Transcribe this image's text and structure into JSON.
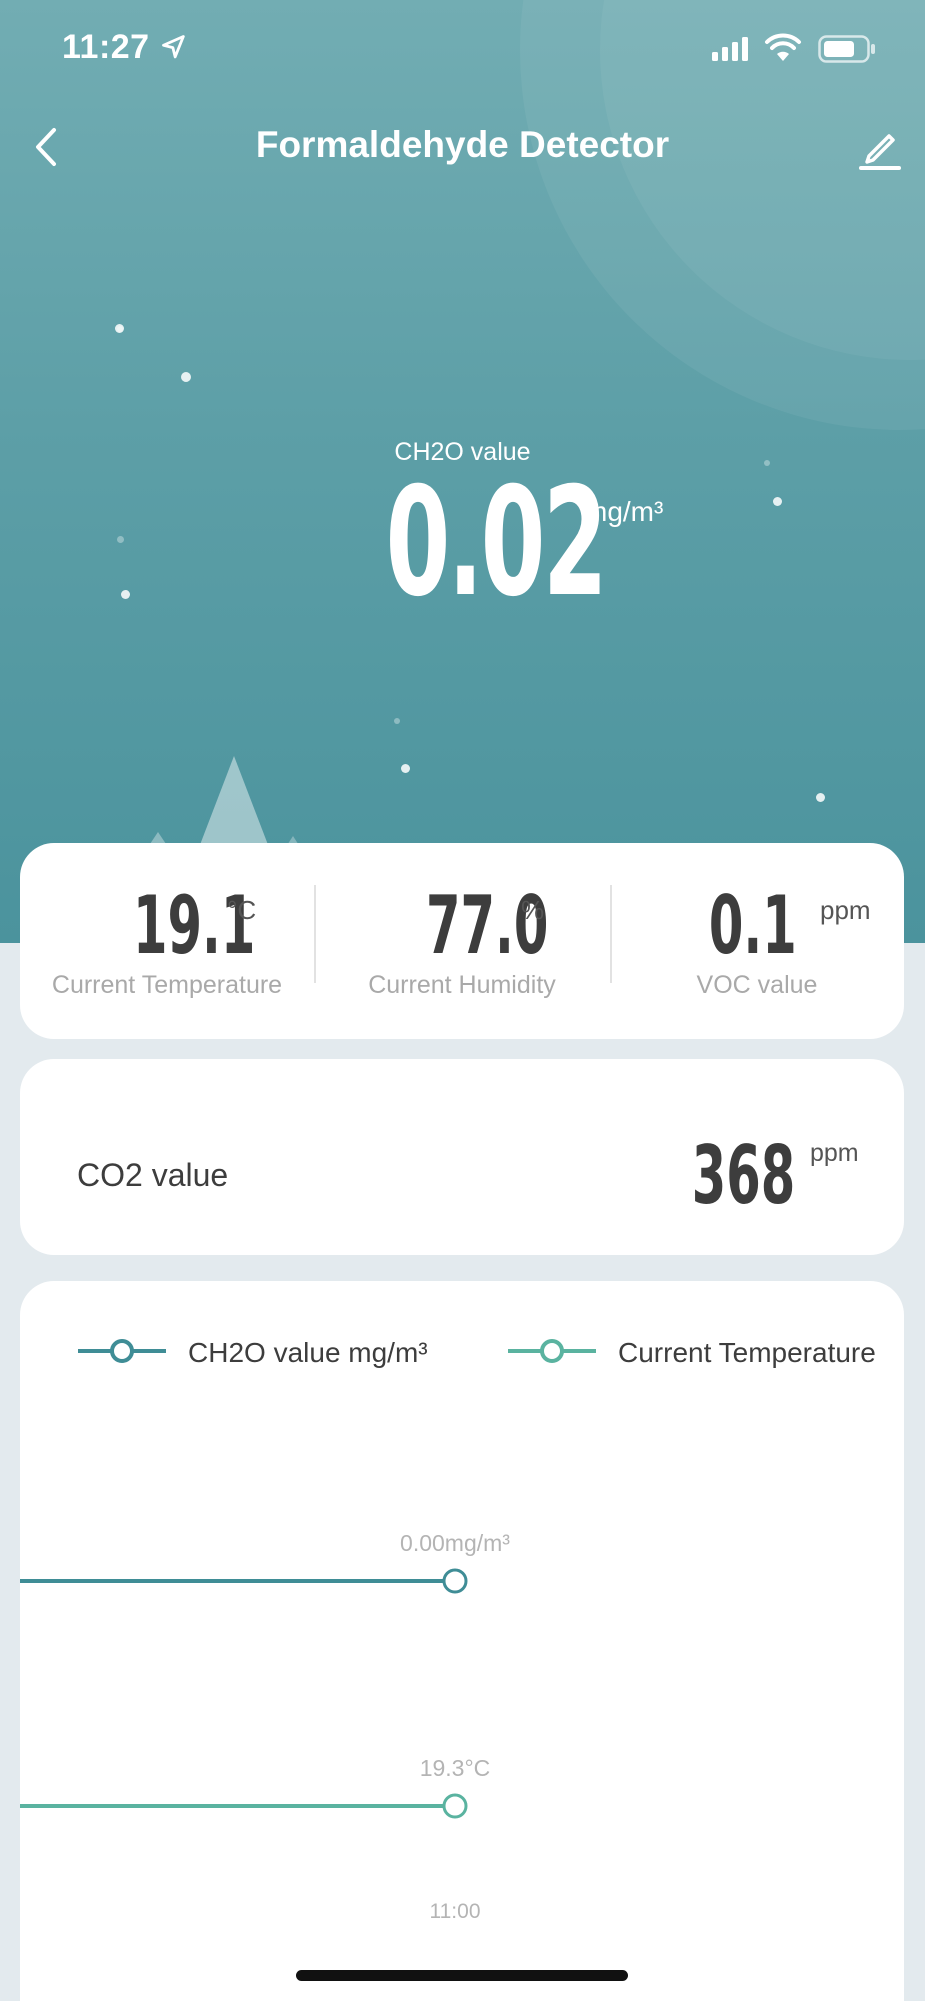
{
  "status_bar": {
    "time": "11:27"
  },
  "nav": {
    "title": "Formaldehyde Detector"
  },
  "main": {
    "ch2o_label": "CH2O value",
    "ch2o_value": "0.02",
    "ch2o_unit": "mg/m³"
  },
  "metrics": [
    {
      "value": "19.1",
      "unit": "°C",
      "label": "Current Temperature"
    },
    {
      "value": "77.0",
      "unit": "%",
      "label": "Current Humidity"
    },
    {
      "value": "0.1",
      "unit": "ppm",
      "label": "VOC value"
    }
  ],
  "co2": {
    "label": "CO2 value",
    "value": "368",
    "unit": "ppm"
  },
  "chart": {
    "legend": [
      {
        "name": "CH2O value mg/m³",
        "color": "#3f8d96"
      },
      {
        "name": "Current Temperature",
        "color": "#5ab3a0"
      }
    ]
  },
  "chart_data": {
    "type": "line",
    "x": [
      "11:00"
    ],
    "series": [
      {
        "name": "CH2O value mg/m³",
        "values": [
          0.0
        ],
        "point_label": "0.00mg/m³",
        "color": "#3f8d96"
      },
      {
        "name": "Current Temperature",
        "values": [
          19.3
        ],
        "point_label": "19.3°C",
        "color": "#5ab3a0"
      }
    ],
    "xlabel": "",
    "ylabel": "",
    "grid": false,
    "legend": "top"
  },
  "colors": {
    "accent": "#4e959f",
    "text_dark": "#3d3d3d",
    "text_muted": "#a9a9a9"
  }
}
